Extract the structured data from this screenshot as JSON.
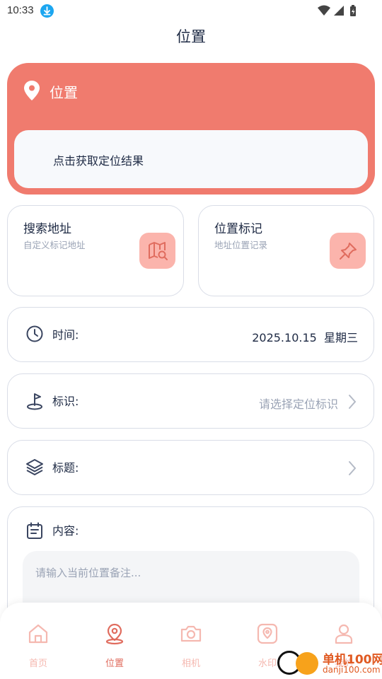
{
  "status_bar": {
    "time": "10:33"
  },
  "page": {
    "title": "位置"
  },
  "hero": {
    "title": "位置",
    "result_text": "点击获取定位结果"
  },
  "tiles": [
    {
      "title": "搜索地址",
      "subtitle": "自定义标记地址",
      "icon": "map-search-icon"
    },
    {
      "title": "位置标记",
      "subtitle": "地址位置记录",
      "icon": "pin-icon"
    }
  ],
  "rows": {
    "time": {
      "label": "时间:",
      "value": "2025.10.15  星期三"
    },
    "marker": {
      "label": "标识:",
      "placeholder": "请选择定位标识"
    },
    "title": {
      "label": "标题:"
    },
    "content": {
      "label": "内容:",
      "placeholder": "请输入当前位置备注..."
    }
  },
  "tabbar": {
    "items": [
      {
        "label": "首页",
        "icon": "home-icon",
        "active": false
      },
      {
        "label": "位置",
        "icon": "location-icon",
        "active": true
      },
      {
        "label": "相机",
        "icon": "camera-icon",
        "active": false
      },
      {
        "label": "水印",
        "icon": "watermark-icon",
        "active": false
      },
      {
        "label": "我的",
        "icon": "user-icon",
        "active": false
      }
    ]
  },
  "watermark": {
    "name": "单机100网",
    "domain": "danji100.com"
  },
  "colors": {
    "accent": "#f07b6e",
    "tile_icon_bg": "#fbb4ac",
    "text_primary": "#1e2a44",
    "text_muted": "#9aa3b5",
    "tab_inactive": "#f5b8b0",
    "tab_active": "#e06c5e"
  }
}
